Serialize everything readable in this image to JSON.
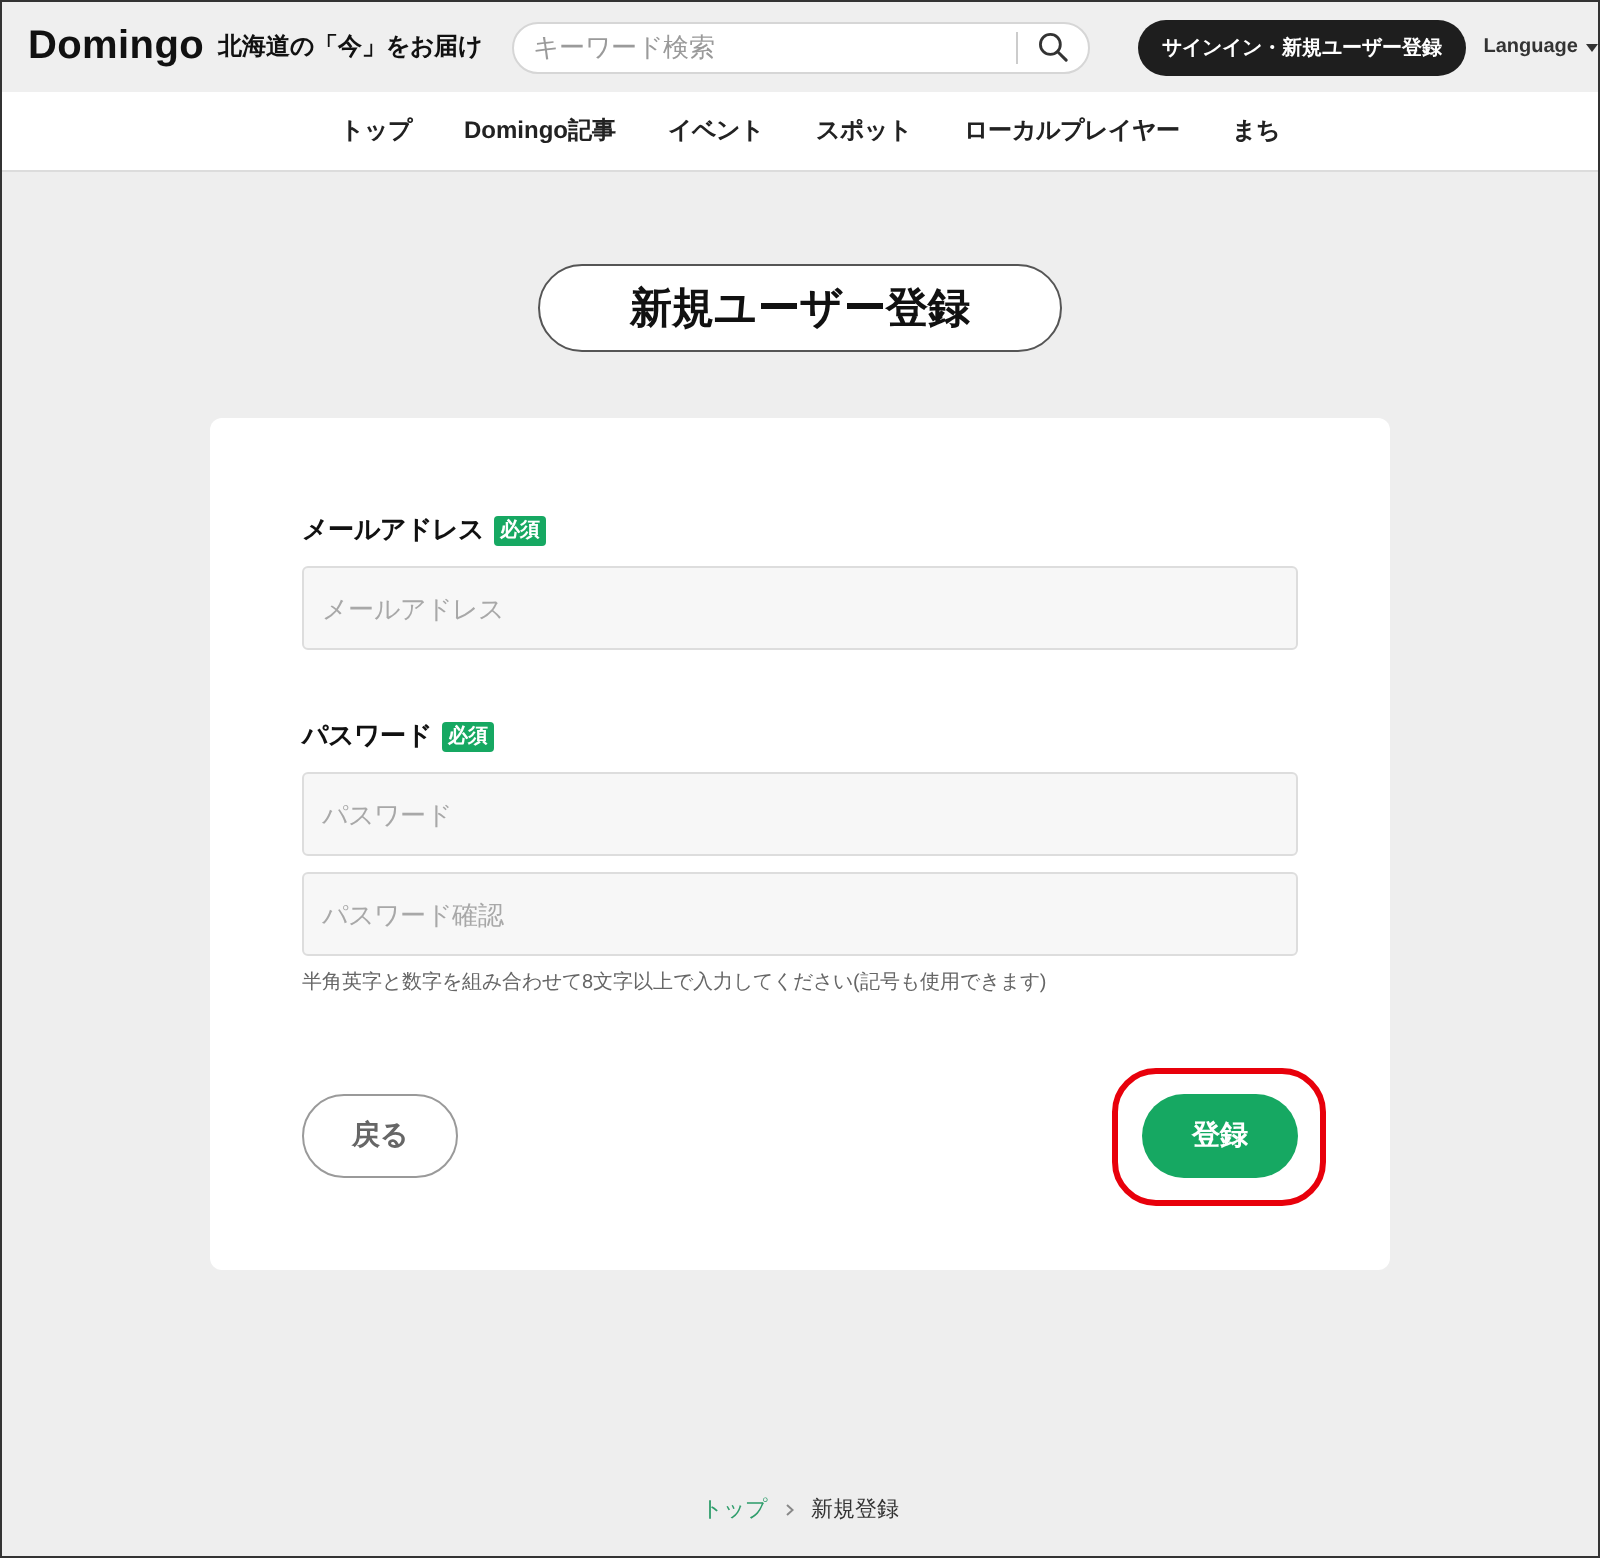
{
  "header": {
    "logo": "Domingo",
    "tagline": "北海道の「今」をお届け",
    "search": {
      "placeholder": "キーワード検索"
    },
    "signin_button": "サインイン・新規ユーザー登録",
    "language": "Language"
  },
  "nav": [
    "トップ",
    "Domingo記事",
    "イベント",
    "スポット",
    "ローカルプレイヤー",
    "まち"
  ],
  "page_title": "新規ユーザー登録",
  "form": {
    "fields": [
      {
        "label": "メールアドレス",
        "required_badge": "必須",
        "inputs": [
          {
            "placeholder": "メールアドレス"
          }
        ]
      },
      {
        "label": "パスワード",
        "required_badge": "必須",
        "inputs": [
          {
            "placeholder": "パスワード"
          },
          {
            "placeholder": "パスワード確認"
          }
        ],
        "hint": "半角英字と数字を組み合わせて8文字以上で入力してください(記号も使用できます)"
      }
    ],
    "back_button": "戻る",
    "submit_button": {
      "label": "登録",
      "highlighted": true
    }
  },
  "breadcrumb": [
    {
      "label": "トップ",
      "kind": "link"
    },
    {
      "label": "新規登録",
      "kind": "current"
    }
  ]
}
